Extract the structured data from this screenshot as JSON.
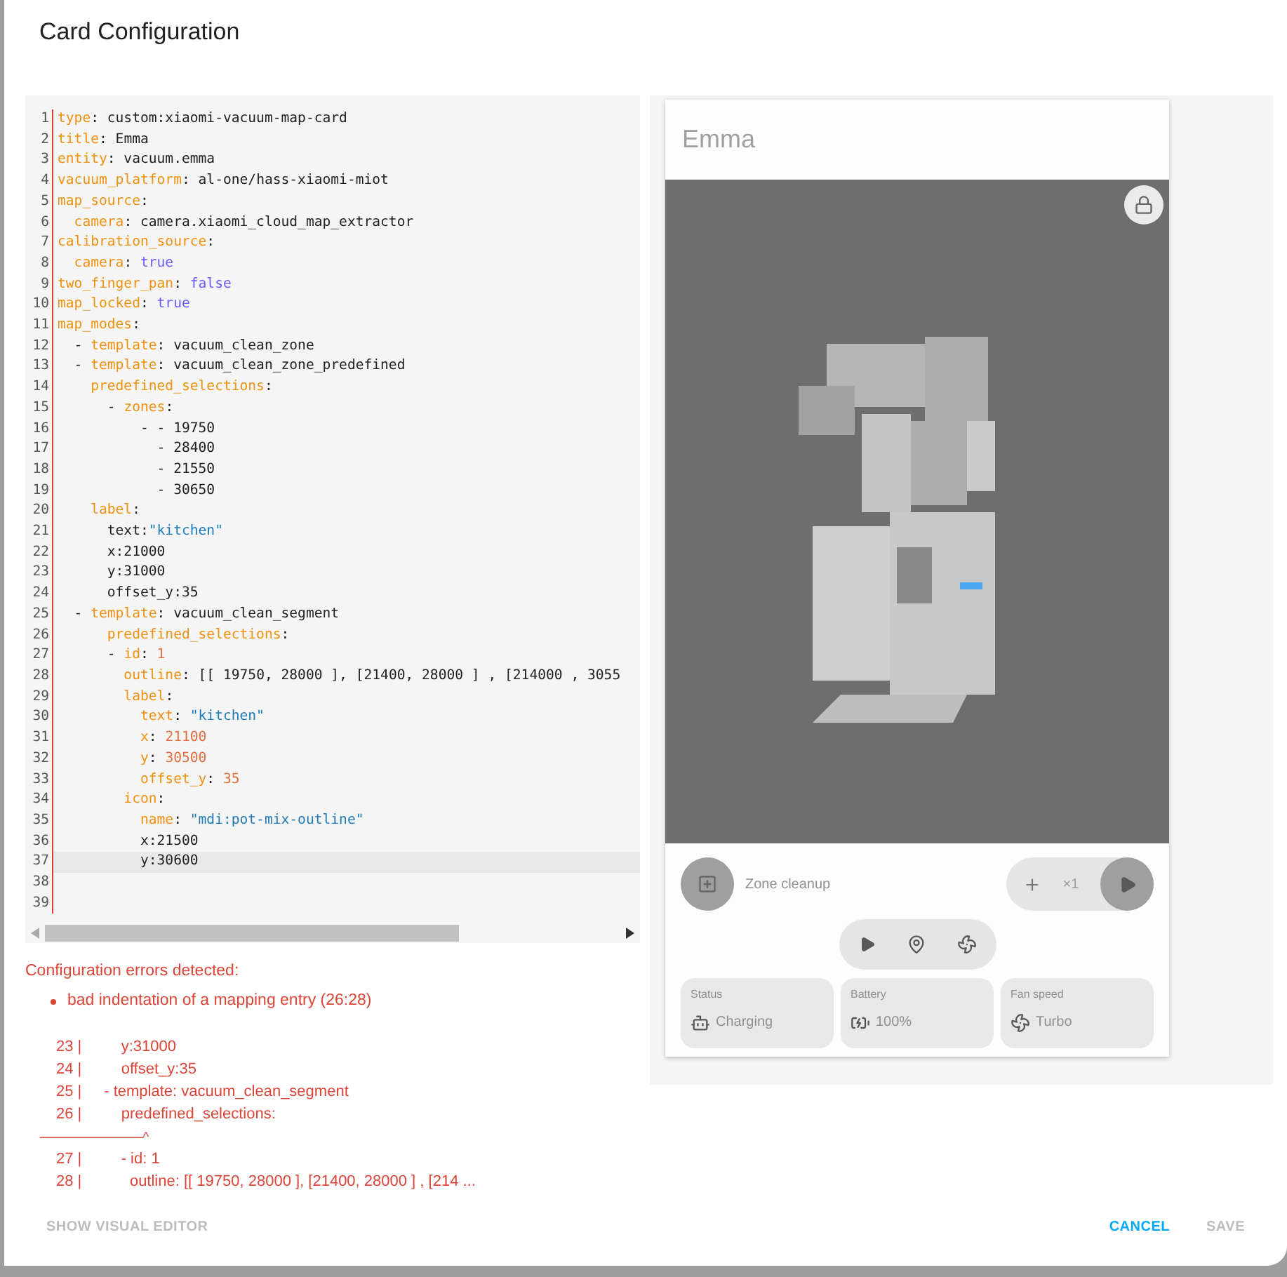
{
  "dialog": {
    "title": "Card Configuration"
  },
  "editor": {
    "lines": [
      {
        "n": "1",
        "active": false,
        "tokens": [
          {
            "kind": "key",
            "text": "type"
          },
          {
            "kind": "plain",
            "text": ": custom:xiaomi-vacuum-map-card"
          }
        ]
      },
      {
        "n": "2",
        "active": false,
        "tokens": [
          {
            "kind": "key",
            "text": "title"
          },
          {
            "kind": "plain",
            "text": ": Emma"
          }
        ]
      },
      {
        "n": "3",
        "active": false,
        "tokens": [
          {
            "kind": "key",
            "text": "entity"
          },
          {
            "kind": "plain",
            "text": ": vacuum.emma"
          }
        ]
      },
      {
        "n": "4",
        "active": false,
        "tokens": [
          {
            "kind": "key",
            "text": "vacuum_platform"
          },
          {
            "kind": "plain",
            "text": ": al-one/hass-xiaomi-miot"
          }
        ]
      },
      {
        "n": "5",
        "active": false,
        "tokens": [
          {
            "kind": "key",
            "text": "map_source"
          },
          {
            "kind": "plain",
            "text": ":"
          }
        ]
      },
      {
        "n": "6",
        "active": false,
        "tokens": [
          {
            "kind": "key",
            "text": "  camera"
          },
          {
            "kind": "plain",
            "text": ": camera.xiaomi_cloud_map_extractor"
          }
        ]
      },
      {
        "n": "7",
        "active": false,
        "tokens": [
          {
            "kind": "key",
            "text": "calibration_source"
          },
          {
            "kind": "plain",
            "text": ":"
          }
        ]
      },
      {
        "n": "8",
        "active": false,
        "tokens": [
          {
            "kind": "key",
            "text": "  camera"
          },
          {
            "kind": "plain",
            "text": ": "
          },
          {
            "kind": "bool",
            "text": "true"
          }
        ]
      },
      {
        "n": "9",
        "active": false,
        "tokens": [
          {
            "kind": "key",
            "text": "two_finger_pan"
          },
          {
            "kind": "plain",
            "text": ": "
          },
          {
            "kind": "bool",
            "text": "false"
          }
        ]
      },
      {
        "n": "10",
        "active": false,
        "tokens": [
          {
            "kind": "key",
            "text": "map_locked"
          },
          {
            "kind": "plain",
            "text": ": "
          },
          {
            "kind": "bool",
            "text": "true"
          }
        ]
      },
      {
        "n": "11",
        "active": false,
        "tokens": [
          {
            "kind": "key",
            "text": "map_modes"
          },
          {
            "kind": "plain",
            "text": ":"
          }
        ]
      },
      {
        "n": "12",
        "active": false,
        "tokens": [
          {
            "kind": "plain",
            "text": "  - "
          },
          {
            "kind": "key",
            "text": "template"
          },
          {
            "kind": "plain",
            "text": ": vacuum_clean_zone"
          }
        ]
      },
      {
        "n": "13",
        "active": false,
        "tokens": [
          {
            "kind": "plain",
            "text": "  - "
          },
          {
            "kind": "key",
            "text": "template"
          },
          {
            "kind": "plain",
            "text": ": vacuum_clean_zone_predefined"
          }
        ]
      },
      {
        "n": "14",
        "active": false,
        "tokens": [
          {
            "kind": "key",
            "text": "    predefined_selections"
          },
          {
            "kind": "plain",
            "text": ":"
          }
        ]
      },
      {
        "n": "15",
        "active": false,
        "tokens": [
          {
            "kind": "plain",
            "text": "      - "
          },
          {
            "kind": "key",
            "text": "zones"
          },
          {
            "kind": "plain",
            "text": ":"
          }
        ]
      },
      {
        "n": "16",
        "active": false,
        "tokens": [
          {
            "kind": "plain",
            "text": "          - - 19750"
          }
        ]
      },
      {
        "n": "17",
        "active": false,
        "tokens": [
          {
            "kind": "plain",
            "text": "            - 28400"
          }
        ]
      },
      {
        "n": "18",
        "active": false,
        "tokens": [
          {
            "kind": "plain",
            "text": "            - 21550"
          }
        ]
      },
      {
        "n": "19",
        "active": false,
        "tokens": [
          {
            "kind": "plain",
            "text": "            - 30650"
          }
        ]
      },
      {
        "n": "20",
        "active": false,
        "tokens": [
          {
            "kind": "key",
            "text": "    label"
          },
          {
            "kind": "plain",
            "text": ":"
          }
        ]
      },
      {
        "n": "21",
        "active": false,
        "tokens": [
          {
            "kind": "plain",
            "text": "      text:"
          },
          {
            "kind": "string",
            "text": "\"kitchen\""
          }
        ]
      },
      {
        "n": "22",
        "active": false,
        "tokens": [
          {
            "kind": "plain",
            "text": "      x:21000"
          }
        ]
      },
      {
        "n": "23",
        "active": false,
        "tokens": [
          {
            "kind": "plain",
            "text": "      y:31000"
          }
        ]
      },
      {
        "n": "24",
        "active": false,
        "tokens": [
          {
            "kind": "plain",
            "text": "      offset_y:35"
          }
        ]
      },
      {
        "n": "25",
        "active": false,
        "tokens": [
          {
            "kind": "plain",
            "text": "  - "
          },
          {
            "kind": "key",
            "text": "template"
          },
          {
            "kind": "plain",
            "text": ": vacuum_clean_segment"
          }
        ]
      },
      {
        "n": "26",
        "active": false,
        "tokens": [
          {
            "kind": "key",
            "text": "      predefined_selections"
          },
          {
            "kind": "plain",
            "text": ":"
          }
        ]
      },
      {
        "n": "27",
        "active": false,
        "tokens": [
          {
            "kind": "plain",
            "text": "      - "
          },
          {
            "kind": "key",
            "text": "id"
          },
          {
            "kind": "plain",
            "text": ": "
          },
          {
            "kind": "number",
            "text": "1"
          }
        ]
      },
      {
        "n": "28",
        "active": false,
        "tokens": [
          {
            "kind": "key",
            "text": "        outline"
          },
          {
            "kind": "plain",
            "text": ": [[ 19750, 28000 ], [21400, 28000 ] , [214000 , 3055"
          }
        ]
      },
      {
        "n": "29",
        "active": false,
        "tokens": [
          {
            "kind": "key",
            "text": "        label"
          },
          {
            "kind": "plain",
            "text": ":"
          }
        ]
      },
      {
        "n": "30",
        "active": false,
        "tokens": [
          {
            "kind": "key",
            "text": "          text"
          },
          {
            "kind": "plain",
            "text": ": "
          },
          {
            "kind": "string",
            "text": "\"kitchen\""
          }
        ]
      },
      {
        "n": "31",
        "active": false,
        "tokens": [
          {
            "kind": "key",
            "text": "          x"
          },
          {
            "kind": "plain",
            "text": ": "
          },
          {
            "kind": "number",
            "text": "21100"
          }
        ]
      },
      {
        "n": "32",
        "active": false,
        "tokens": [
          {
            "kind": "key",
            "text": "          y"
          },
          {
            "kind": "plain",
            "text": ": "
          },
          {
            "kind": "number",
            "text": "30500"
          }
        ]
      },
      {
        "n": "33",
        "active": false,
        "tokens": [
          {
            "kind": "key",
            "text": "          offset_y"
          },
          {
            "kind": "plain",
            "text": ": "
          },
          {
            "kind": "number",
            "text": "35"
          }
        ]
      },
      {
        "n": "34",
        "active": false,
        "tokens": [
          {
            "kind": "key",
            "text": "        icon"
          },
          {
            "kind": "plain",
            "text": ":"
          }
        ]
      },
      {
        "n": "35",
        "active": false,
        "tokens": [
          {
            "kind": "key",
            "text": "          name"
          },
          {
            "kind": "plain",
            "text": ": "
          },
          {
            "kind": "string",
            "text": "\"mdi:pot-mix-outline\""
          }
        ]
      },
      {
        "n": "36",
        "active": false,
        "tokens": [
          {
            "kind": "plain",
            "text": "          x:21500"
          }
        ]
      },
      {
        "n": "37",
        "active": true,
        "tokens": [
          {
            "kind": "plain",
            "text": "          y:30600"
          }
        ]
      },
      {
        "n": "38",
        "active": false
      },
      {
        "n": "39",
        "active": false
      }
    ]
  },
  "errors": {
    "heading": "Configuration errors detected:",
    "items": [
      "bad indentation of a mapping entry (26:28)"
    ],
    "snippet": [
      {
        "kind": "line",
        "gutter": "23 |",
        "text": "      y:31000"
      },
      {
        "kind": "line",
        "gutter": "24 |",
        "text": "      offset_y:35"
      },
      {
        "kind": "line",
        "gutter": "25 |",
        "text": "  - template: vacuum_clean_segment"
      },
      {
        "kind": "line",
        "gutter": "26 |",
        "text": "      predefined_selections:"
      },
      {
        "kind": "pointer",
        "text": "-------------------------------------^"
      },
      {
        "kind": "line",
        "gutter": "27 |",
        "text": "      - id: 1"
      },
      {
        "kind": "line",
        "gutter": "28 |",
        "text": "        outline: [[ 19750, 28000 ], [21400, 28000 ] , [214 ..."
      }
    ]
  },
  "preview": {
    "title": "Emma",
    "mode": "Zone cleanup",
    "repeat": "×1",
    "tiles": [
      {
        "kind": "status",
        "label": "Status",
        "value": "Charging"
      },
      {
        "kind": "battery",
        "label": "Battery",
        "value": "100%"
      },
      {
        "kind": "fan",
        "label": "Fan speed",
        "value": "Turbo"
      }
    ]
  },
  "footer": {
    "buttons": [
      {
        "label": "SHOW VISUAL EDITOR",
        "disabled": true
      },
      {
        "label": "CANCEL",
        "disabled": false
      },
      {
        "label": "SAVE",
        "disabled": true
      }
    ]
  }
}
